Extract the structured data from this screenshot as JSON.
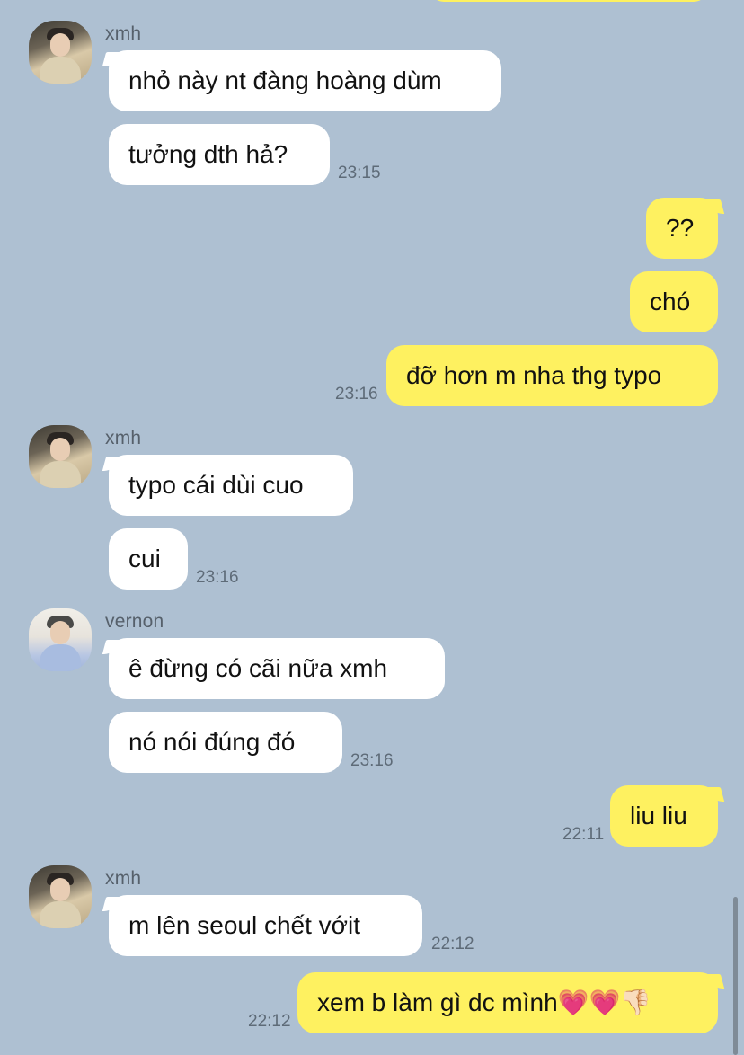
{
  "colors": {
    "background": "#aec0d2",
    "incoming_bubble": "#ffffff",
    "outgoing_bubble": "#fef160",
    "timestamp": "#5e6b78",
    "sender_name": "#56606b"
  },
  "messages": [
    {
      "sender": "xmh",
      "avatar": "xmh-avatar",
      "text": "nhỏ này nt đàng hoàng dùm"
    },
    {
      "text": "tưởng dth hả?",
      "time": "23:15"
    },
    {
      "text": "??"
    },
    {
      "text": "chó"
    },
    {
      "text": "đỡ hơn m nha thg typo",
      "time": "23:16"
    },
    {
      "sender": "xmh",
      "avatar": "xmh-avatar",
      "text": "typo cái dùi cuo"
    },
    {
      "text": "cui",
      "time": "23:16"
    },
    {
      "sender": "vernon",
      "avatar": "vernon-avatar",
      "text": "ê đừng có cãi nữa xmh"
    },
    {
      "text": "nó nói đúng đó",
      "time": "23:16"
    },
    {
      "text": "liu liu",
      "time": "22:11"
    },
    {
      "sender": "xmh",
      "avatar": "xmh-avatar",
      "text": "m lên seoul chết vớit",
      "time": "22:12"
    },
    {
      "text": "xem b làm gì dc mình💗💗👎🏻",
      "time": "22:12"
    }
  ]
}
